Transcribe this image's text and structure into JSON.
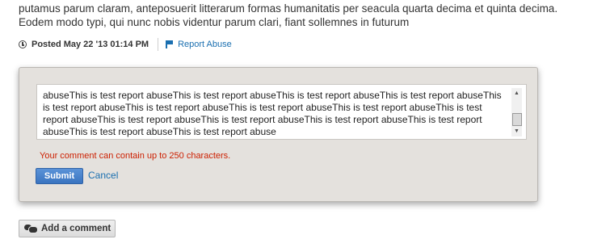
{
  "comment": {
    "line1": "putamus parum claram, anteposuerit litterarum formas humanitatis per seacula quarta decima et quinta decima.",
    "line2": "Eodem modo typi, qui nunc nobis videntur parum clari, fiant sollemnes in futurum"
  },
  "meta": {
    "posted_label": "Posted May 22 '13 01:14 PM",
    "report_label": "Report Abuse"
  },
  "report_modal": {
    "textarea_value": "abuseThis is test report abuseThis is test report abuseThis is test report abuseThis is test report abuseThis is test report abuseThis is test report abuseThis is test report abuseThis is test report abuseThis is test report abuseThis is test report abuseThis is test report abuseThis is test report abuseThis is test report abuseThis is test report abuseThis is test report abuse",
    "char_hint": "Your comment can contain up to 250 characters.",
    "submit_label": "Submit",
    "cancel_label": "Cancel"
  },
  "add_comment": {
    "label": "Add a comment"
  },
  "colors": {
    "link": "#1a6fb0",
    "error": "#cc1f00",
    "submit_bg": "#4a84cc",
    "modal_bg": "#e4e1dd"
  },
  "icons": {
    "posted": "clock-icon",
    "report": "flag-icon",
    "add_comment": "chat-bubbles-icon"
  }
}
